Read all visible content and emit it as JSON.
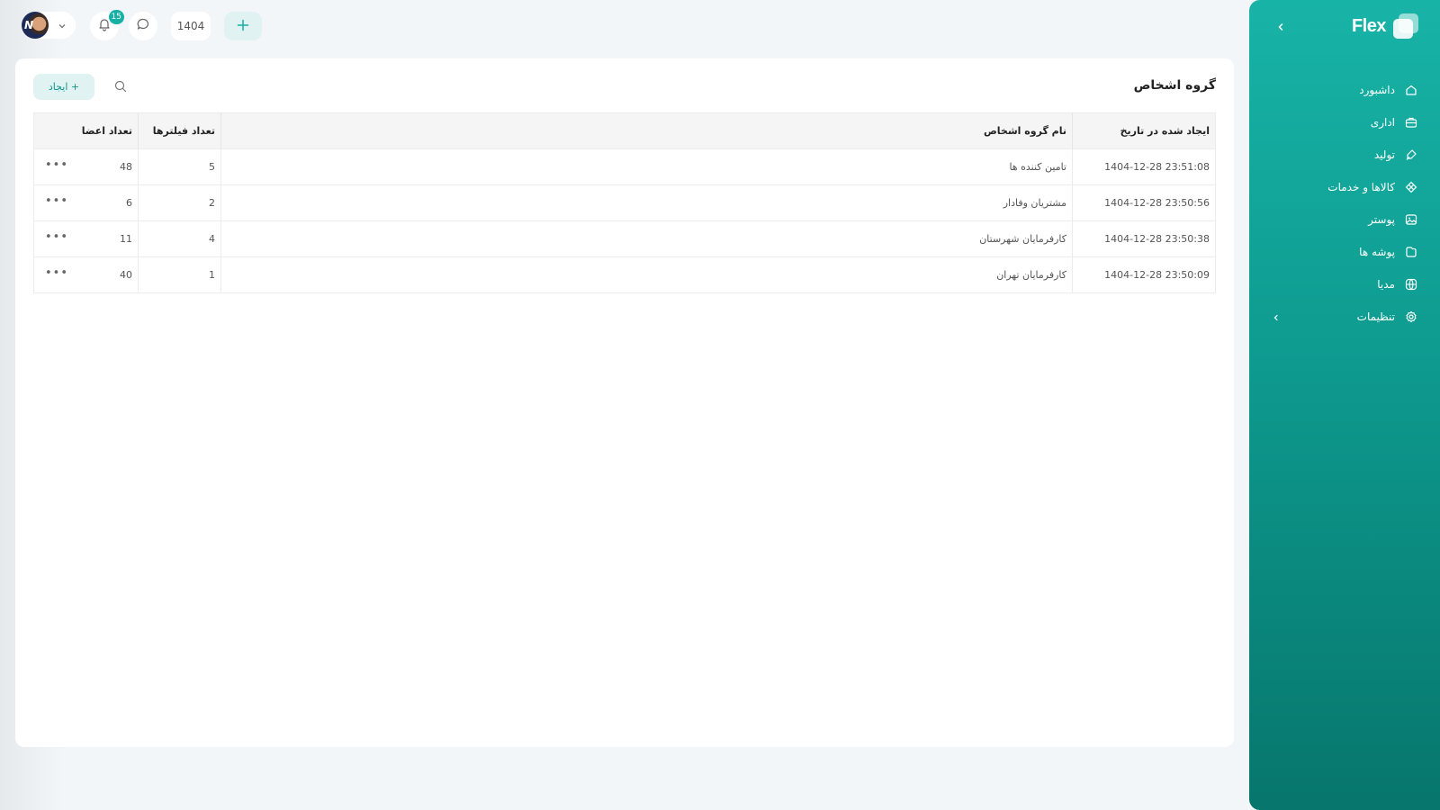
{
  "sidebar": {
    "brand": "Flex",
    "items": [
      {
        "label": "داشبورد",
        "icon": "home-icon"
      },
      {
        "label": "اداری",
        "icon": "briefcase-icon"
      },
      {
        "label": "تولید",
        "icon": "pen-tool-icon"
      },
      {
        "label": "کالاها و خدمات",
        "icon": "diamond-grid-icon"
      },
      {
        "label": "پوستر",
        "icon": "image-icon"
      },
      {
        "label": "پوشه ها",
        "icon": "folder-icon"
      },
      {
        "label": "مدیا",
        "icon": "globe-icon"
      },
      {
        "label": "تنظیمات",
        "icon": "gear-icon",
        "has_submenu": true
      }
    ]
  },
  "topbar": {
    "notifications_count": "15",
    "year": "1404"
  },
  "page": {
    "title": "گروه اشخاص",
    "create_label": "+ ایجاد"
  },
  "table": {
    "columns": [
      "ایجاد شده در تاریخ",
      "نام گروه اشخاص",
      "تعداد فیلترها",
      "تعداد اعضا"
    ],
    "rows": [
      {
        "created": "1404-12-28 23:51:08",
        "name": "تامین کننده ها",
        "filters": "5",
        "members": "48"
      },
      {
        "created": "1404-12-28 23:50:56",
        "name": "مشتریان وفادار",
        "filters": "2",
        "members": "6"
      },
      {
        "created": "1404-12-28 23:50:38",
        "name": "کارفرمایان شهرستان",
        "filters": "4",
        "members": "11"
      },
      {
        "created": "1404-12-28 23:50:09",
        "name": "کارفرمایان تهران",
        "filters": "1",
        "members": "40"
      }
    ],
    "row_actions_label": "•••"
  },
  "colors": {
    "accent": "#17b0a4",
    "accent_light": "#e0f2f1",
    "sidebar_bottom": "#07766c"
  }
}
